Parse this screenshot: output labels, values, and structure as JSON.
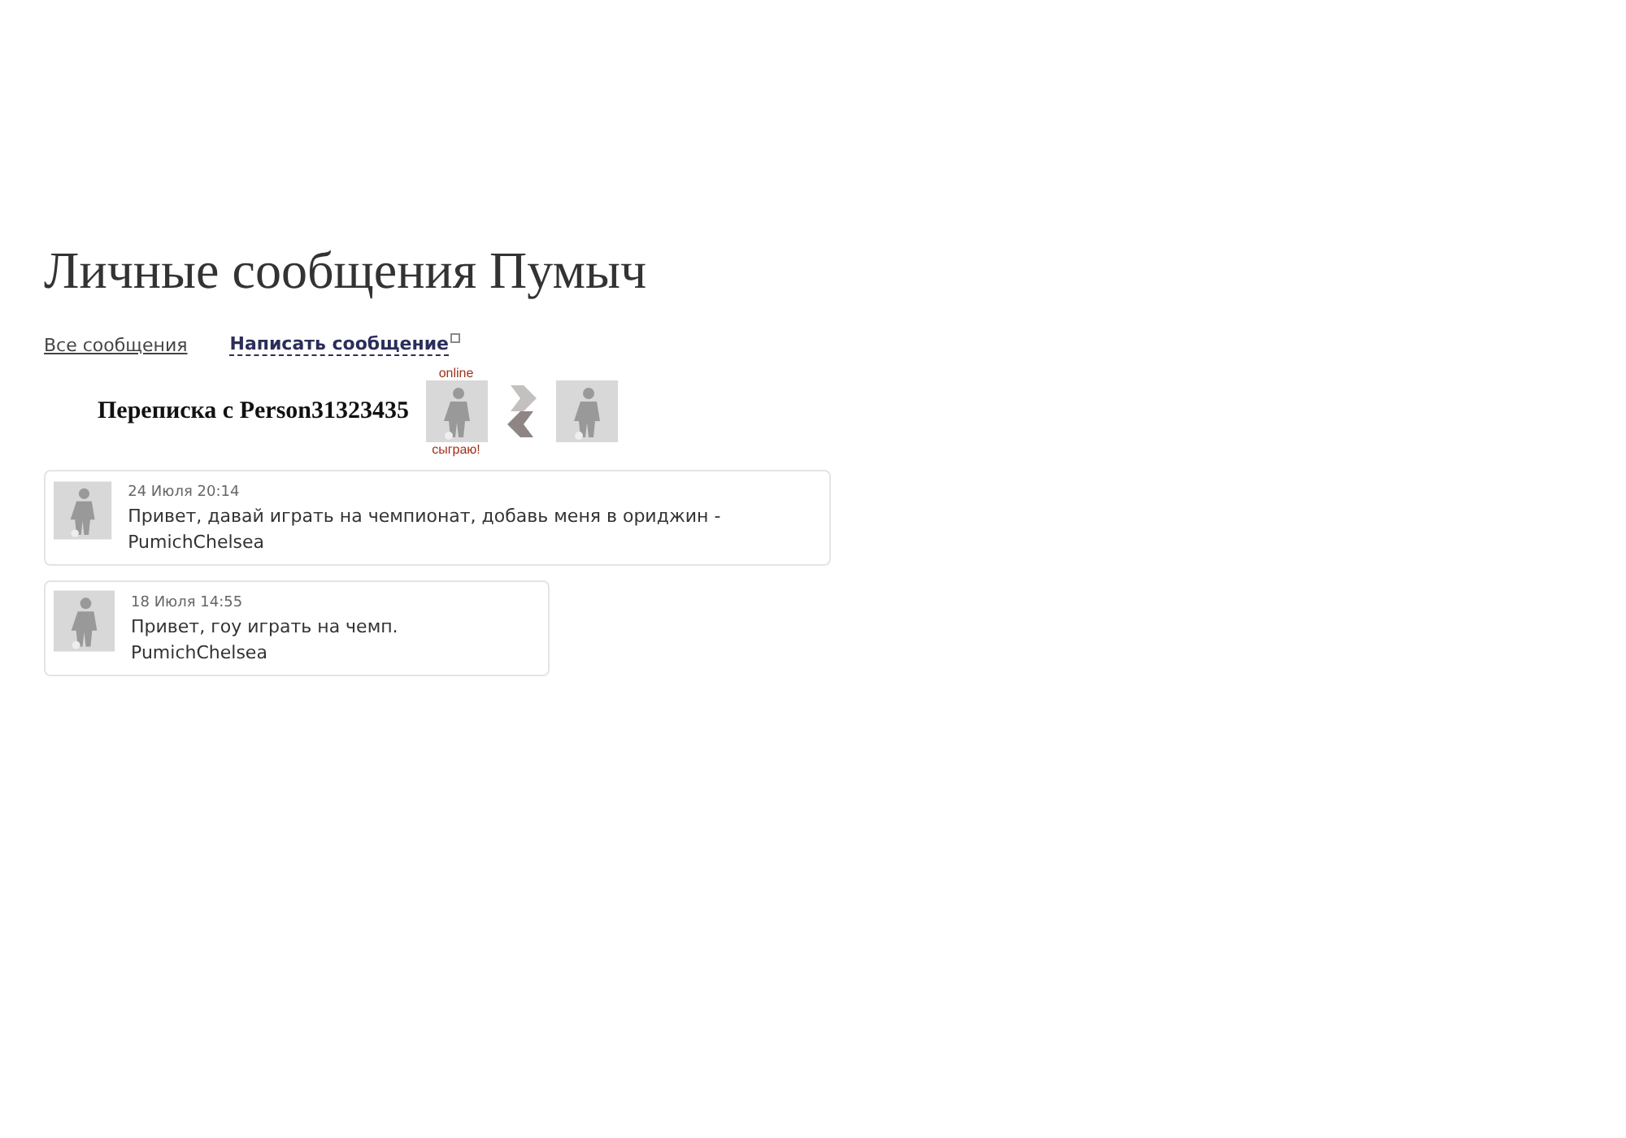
{
  "title": "Личные сообщения Пумыч",
  "nav": [
    {
      "label": "Все сообщения",
      "selected": false
    },
    {
      "label": "Написать сообщение",
      "selected": true
    }
  ],
  "conversation": {
    "heading": "Переписка с Person31323435",
    "status": "online",
    "play_label": "сыграю!"
  },
  "messages": [
    {
      "time": "24 Июля 20:14",
      "text": "Привет, давай играть на чемпионат, добавь меня в ориджин - PumichChelsea"
    },
    {
      "time": "18 Июля 14:55",
      "text": "Привет, гоу играть на чемп. PumichChelsea"
    }
  ]
}
